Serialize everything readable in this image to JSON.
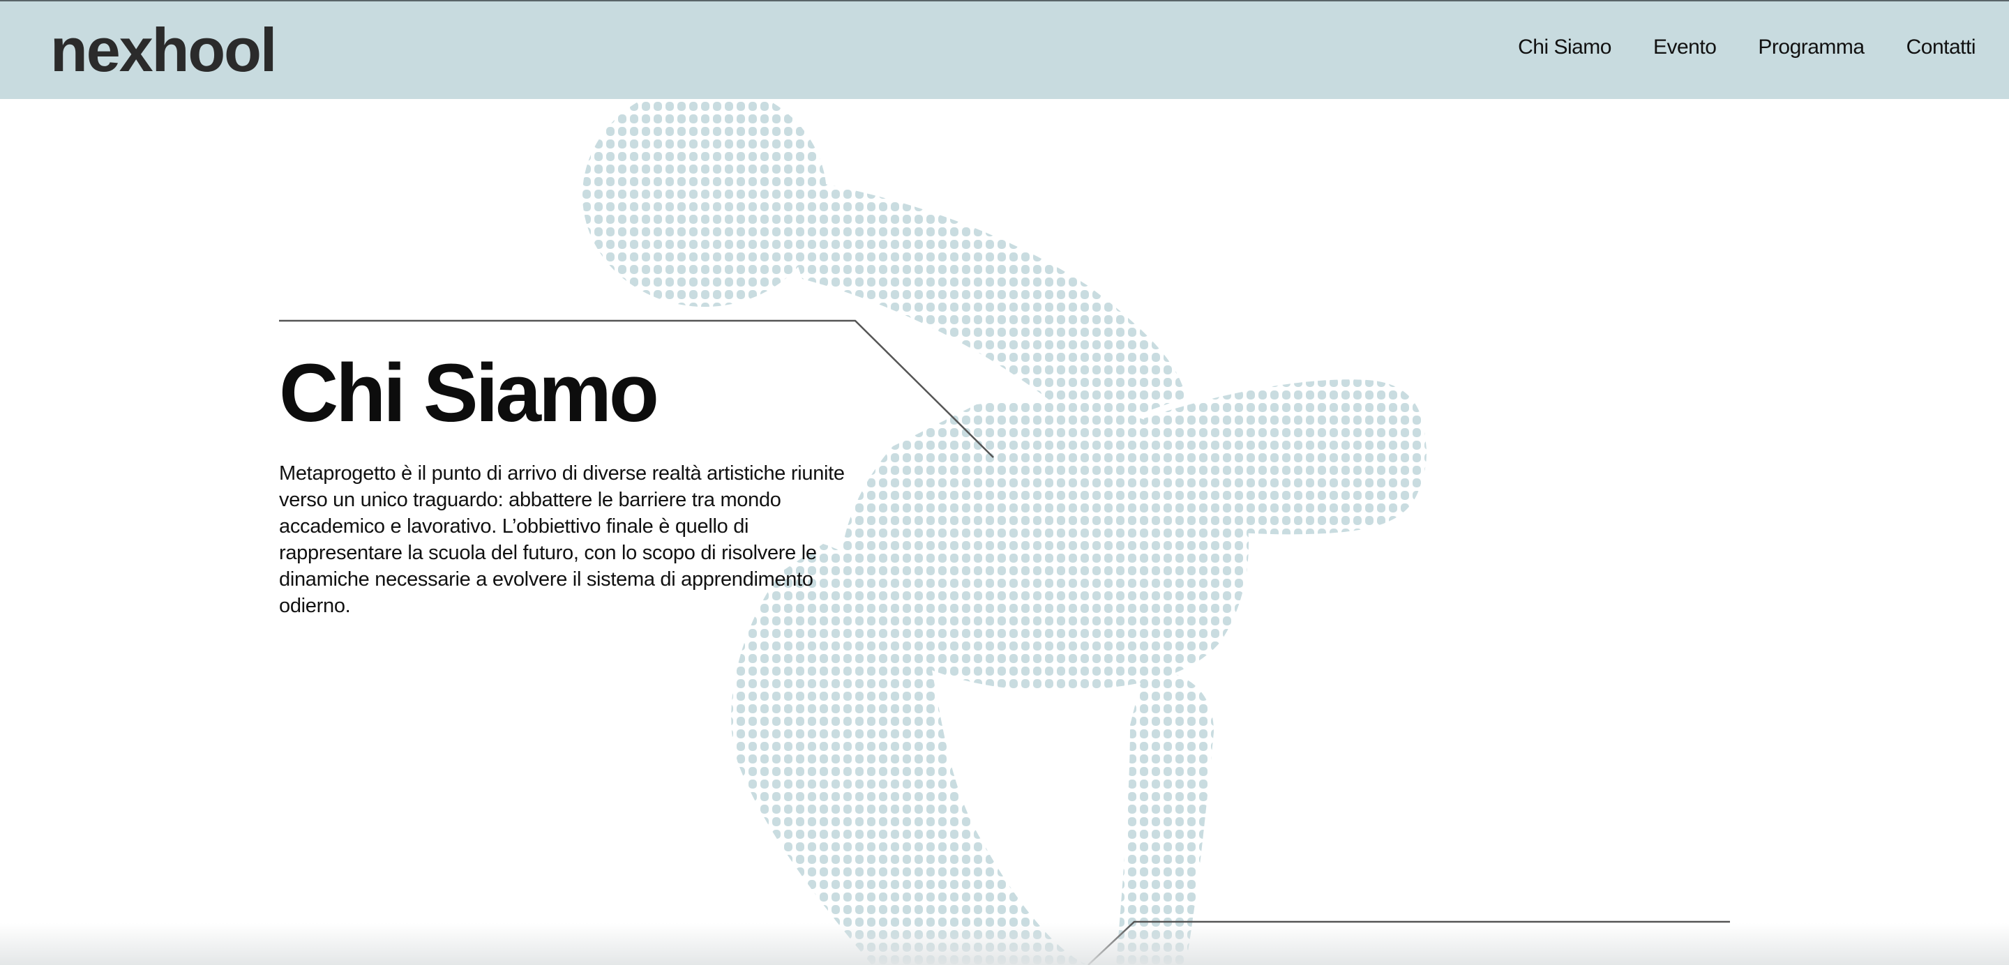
{
  "header": {
    "logo": "nexhool",
    "nav": [
      {
        "label": "Chi Siamo"
      },
      {
        "label": "Evento"
      },
      {
        "label": "Programma"
      },
      {
        "label": "Contatti"
      }
    ]
  },
  "section": {
    "title": "Chi Siamo",
    "body": "Metaprogetto è il punto di arrivo di diverse realtà artistiche riunite verso un unico traguardo: abbattere le barriere tra mondo accademico e lavorativo. L’obbiettivo finale è quello di rappresentare la scuola del futuro, con lo scopo di risolvere le dinamiche necessarie a evolvere il sistema di apprendimento odierno."
  },
  "colors": {
    "header_bg": "#c8dbdf",
    "dot_color": "#c9dce0",
    "line_color": "#555555"
  },
  "illustration": {
    "icon": "halftone-dancer-figure"
  }
}
